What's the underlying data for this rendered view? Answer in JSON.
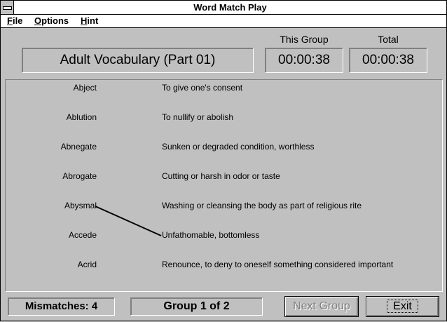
{
  "window": {
    "title": "Word Match Play"
  },
  "menu": [
    "File",
    "Options",
    "Hint"
  ],
  "header": {
    "group_title": "Adult Vocabulary (Part 01)",
    "this_group_label": "This Group",
    "this_group_time": "00:00:38",
    "total_label": "Total",
    "total_time": "00:00:38"
  },
  "words": [
    "Abject",
    "Ablution",
    "Abnegate",
    "Abrogate",
    "Abysmal",
    "Accede",
    "Acrid"
  ],
  "definitions": [
    "To give one's consent",
    "To nullify or abolish",
    "Sunken or degraded condition, worthless",
    "Cutting or harsh in odor or taste",
    "Washing or cleansing the body as part of religious rite",
    "Unfathomable, bottomless",
    "Renounce, to deny to oneself something considered important"
  ],
  "footer": {
    "mismatches": "Mismatches: 4",
    "group": "Group 1 of 2",
    "next_label": "Next Group",
    "exit_label": "Exit"
  },
  "colors": {
    "background": "#c0c0c0",
    "disabled_text": "#808080",
    "titlebar": "#ffffff"
  }
}
